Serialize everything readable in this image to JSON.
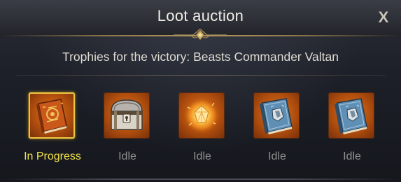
{
  "window": {
    "title": "Loot auction",
    "close_label": "X"
  },
  "subtitle": "Trophies for the victory: Beasts Commander Valtan",
  "items": [
    {
      "icon": "ornate-book-icon",
      "status": "In Progress",
      "selected": true
    },
    {
      "icon": "treasure-chest-icon",
      "status": "Idle",
      "selected": false
    },
    {
      "icon": "glowing-gem-icon",
      "status": "Idle",
      "selected": false
    },
    {
      "icon": "blue-engraving-book-icon",
      "status": "Idle",
      "selected": false
    },
    {
      "icon": "blue-engraving-book-icon",
      "status": "Idle",
      "selected": false
    }
  ],
  "colors": {
    "active_status": "#f2e24a",
    "idle_status": "#8f8f8f",
    "item_background": "#b24f0e",
    "selected_border": "#e8c545"
  }
}
